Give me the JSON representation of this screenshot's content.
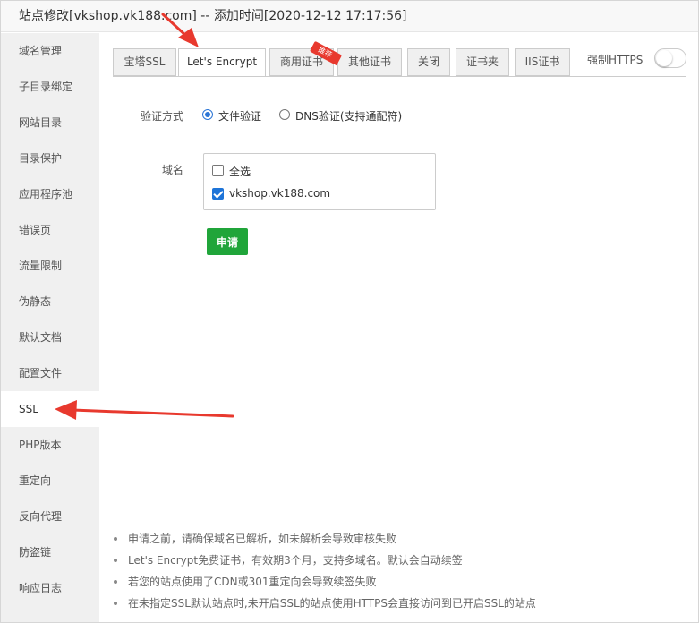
{
  "window": {
    "title": "站点修改[vkshop.vk188.com] -- 添加时间[2020-12-12 17:17:56]"
  },
  "sidebar": {
    "items": [
      {
        "label": "域名管理"
      },
      {
        "label": "子目录绑定"
      },
      {
        "label": "网站目录"
      },
      {
        "label": "目录保护"
      },
      {
        "label": "应用程序池"
      },
      {
        "label": "错误页"
      },
      {
        "label": "流量限制"
      },
      {
        "label": "伪静态"
      },
      {
        "label": "默认文档"
      },
      {
        "label": "配置文件"
      },
      {
        "label": "SSL"
      },
      {
        "label": "PHP版本"
      },
      {
        "label": "重定向"
      },
      {
        "label": "反向代理"
      },
      {
        "label": "防盗链"
      },
      {
        "label": "响应日志"
      }
    ],
    "active": "SSL"
  },
  "tabs": {
    "items": [
      {
        "label": "宝塔SSL"
      },
      {
        "label": "Let's Encrypt"
      },
      {
        "label": "商用证书"
      },
      {
        "label": "其他证书"
      },
      {
        "label": "关闭"
      },
      {
        "label": "证书夹"
      },
      {
        "label": "IIS证书"
      }
    ],
    "active": "Let's Encrypt",
    "ribbon_label": "推荐"
  },
  "force_https": {
    "label": "强制HTTPS",
    "enabled": false
  },
  "form": {
    "verify_label": "验证方式",
    "verify_options": [
      {
        "label": "文件验证",
        "checked": true
      },
      {
        "label": "DNS验证(支持通配符)",
        "checked": false
      }
    ],
    "domain_label": "域名",
    "select_all_label": "全选",
    "domains": [
      {
        "label": "vkshop.vk188.com",
        "checked": true
      }
    ],
    "apply_label": "申请"
  },
  "notes": [
    "申请之前，请确保域名已解析，如未解析会导致审核失败",
    "Let's Encrypt免费证书，有效期3个月，支持多域名。默认会自动续签",
    "若您的站点使用了CDN或301重定向会导致续签失败",
    "在未指定SSL默认站点时,未开启SSL的站点使用HTTPS会直接访问到已开启SSL的站点"
  ],
  "colors": {
    "primary_green": "#20a53a",
    "annotation_red": "#e8392e",
    "radio_blue": "#2b75d6"
  }
}
